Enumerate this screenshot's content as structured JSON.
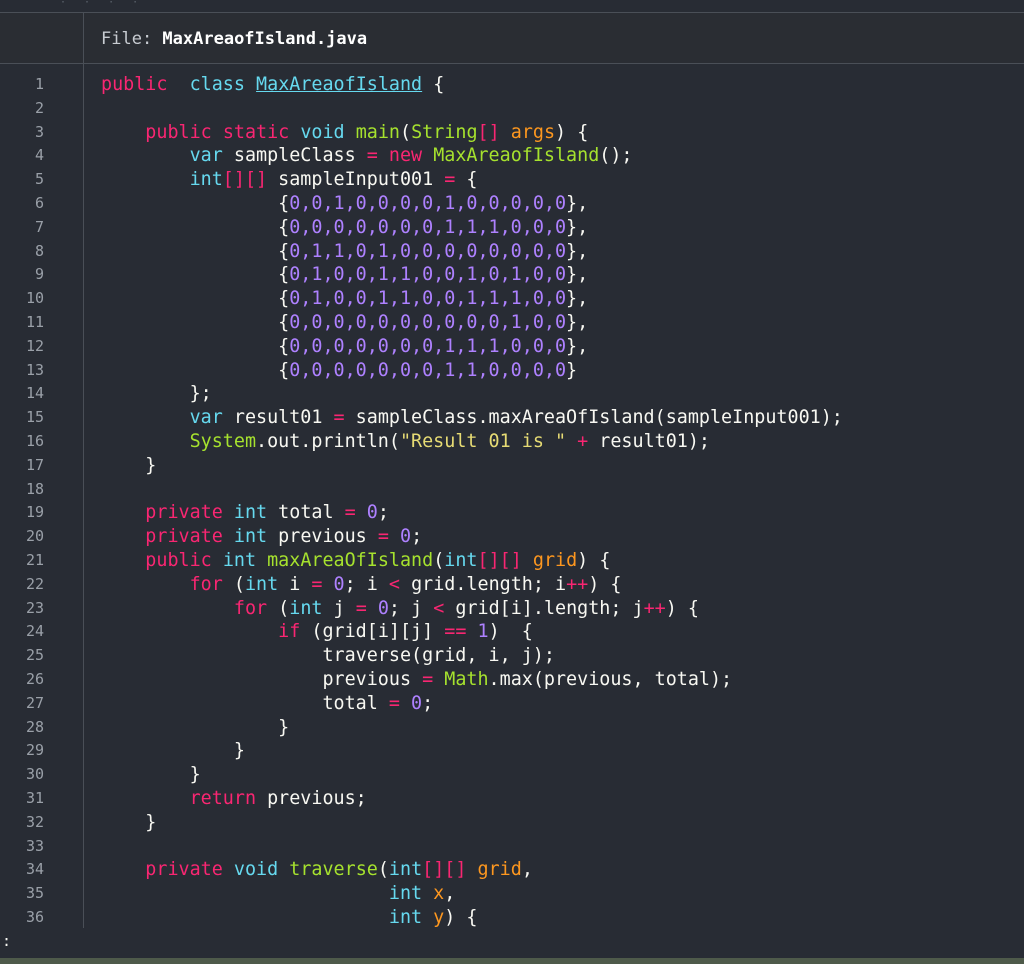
{
  "window": {
    "file_prefix": "File: ",
    "file_name": "MaxAreaofIsland.java"
  },
  "colors": {
    "background": "#282c34",
    "keyword": "#f92672",
    "type": "#66d9ef",
    "function": "#a6e22e",
    "number": "#ae81ff",
    "string": "#e6db74",
    "parameter": "#fd971f"
  },
  "code_lines": [
    {
      "n": "1",
      "tokens": [
        [
          "kw",
          "public"
        ],
        [
          "",
          "  "
        ],
        [
          "ty",
          "class"
        ],
        [
          "",
          " "
        ],
        [
          "ul",
          "MaxAreaofIsland"
        ],
        [
          "",
          " {"
        ]
      ]
    },
    {
      "n": "2",
      "tokens": []
    },
    {
      "n": "3",
      "tokens": [
        [
          "",
          "    "
        ],
        [
          "kw",
          "public"
        ],
        [
          "",
          " "
        ],
        [
          "kw",
          "static"
        ],
        [
          "",
          " "
        ],
        [
          "ty",
          "void"
        ],
        [
          "",
          " "
        ],
        [
          "fn",
          "main"
        ],
        [
          "",
          "("
        ],
        [
          "fn",
          "String"
        ],
        [
          "kw",
          "[]"
        ],
        [
          "",
          " "
        ],
        [
          "pa",
          "args"
        ],
        [
          "",
          ") {"
        ]
      ]
    },
    {
      "n": "4",
      "tokens": [
        [
          "",
          "        "
        ],
        [
          "ty",
          "var"
        ],
        [
          "",
          " sampleClass "
        ],
        [
          "kw",
          "="
        ],
        [
          "",
          " "
        ],
        [
          "kw",
          "new"
        ],
        [
          "",
          " "
        ],
        [
          "fn",
          "MaxAreaofIsland"
        ],
        [
          "",
          "();"
        ]
      ]
    },
    {
      "n": "5",
      "tokens": [
        [
          "",
          "        "
        ],
        [
          "ty",
          "int"
        ],
        [
          "kw",
          "[][]"
        ],
        [
          "",
          " sampleInput001 "
        ],
        [
          "kw",
          "="
        ],
        [
          "",
          " {"
        ]
      ]
    },
    {
      "n": "6",
      "tokens": [
        [
          "",
          "                {"
        ],
        [
          "nu",
          "0,0,1,0,0,0,0,1,0,0,0,0,0"
        ],
        [
          "",
          "},"
        ]
      ]
    },
    {
      "n": "7",
      "tokens": [
        [
          "",
          "                {"
        ],
        [
          "nu",
          "0,0,0,0,0,0,0,1,1,1,0,0,0"
        ],
        [
          "",
          "},"
        ]
      ]
    },
    {
      "n": "8",
      "tokens": [
        [
          "",
          "                {"
        ],
        [
          "nu",
          "0,1,1,0,1,0,0,0,0,0,0,0,0"
        ],
        [
          "",
          "},"
        ]
      ]
    },
    {
      "n": "9",
      "tokens": [
        [
          "",
          "                {"
        ],
        [
          "nu",
          "0,1,0,0,1,1,0,0,1,0,1,0,0"
        ],
        [
          "",
          "},"
        ]
      ]
    },
    {
      "n": "10",
      "tokens": [
        [
          "",
          "                {"
        ],
        [
          "nu",
          "0,1,0,0,1,1,0,0,1,1,1,0,0"
        ],
        [
          "",
          "},"
        ]
      ]
    },
    {
      "n": "11",
      "tokens": [
        [
          "",
          "                {"
        ],
        [
          "nu",
          "0,0,0,0,0,0,0,0,0,0,1,0,0"
        ],
        [
          "",
          "},"
        ]
      ]
    },
    {
      "n": "12",
      "tokens": [
        [
          "",
          "                {"
        ],
        [
          "nu",
          "0,0,0,0,0,0,0,1,1,1,0,0,0"
        ],
        [
          "",
          "},"
        ]
      ]
    },
    {
      "n": "13",
      "tokens": [
        [
          "",
          "                {"
        ],
        [
          "nu",
          "0,0,0,0,0,0,0,1,1,0,0,0,0"
        ],
        [
          "",
          "}"
        ]
      ]
    },
    {
      "n": "14",
      "tokens": [
        [
          "",
          "        };"
        ]
      ]
    },
    {
      "n": "15",
      "tokens": [
        [
          "",
          "        "
        ],
        [
          "ty",
          "var"
        ],
        [
          "",
          " result01 "
        ],
        [
          "kw",
          "="
        ],
        [
          "",
          " sampleClass.maxAreaOfIsland(sampleInput001);"
        ]
      ]
    },
    {
      "n": "16",
      "tokens": [
        [
          "",
          "        "
        ],
        [
          "fn",
          "System"
        ],
        [
          "",
          ".out.println("
        ],
        [
          "st",
          "\"Result 01 is \""
        ],
        [
          "",
          " "
        ],
        [
          "kw",
          "+"
        ],
        [
          "",
          " result01);"
        ]
      ]
    },
    {
      "n": "17",
      "tokens": [
        [
          "",
          "    }"
        ]
      ]
    },
    {
      "n": "18",
      "tokens": []
    },
    {
      "n": "19",
      "tokens": [
        [
          "",
          "    "
        ],
        [
          "kw",
          "private"
        ],
        [
          "",
          " "
        ],
        [
          "ty",
          "int"
        ],
        [
          "",
          " total "
        ],
        [
          "kw",
          "="
        ],
        [
          "",
          " "
        ],
        [
          "nu",
          "0"
        ],
        [
          "",
          ";"
        ]
      ]
    },
    {
      "n": "20",
      "tokens": [
        [
          "",
          "    "
        ],
        [
          "kw",
          "private"
        ],
        [
          "",
          " "
        ],
        [
          "ty",
          "int"
        ],
        [
          "",
          " previous "
        ],
        [
          "kw",
          "="
        ],
        [
          "",
          " "
        ],
        [
          "nu",
          "0"
        ],
        [
          "",
          ";"
        ]
      ]
    },
    {
      "n": "21",
      "tokens": [
        [
          "",
          "    "
        ],
        [
          "kw",
          "public"
        ],
        [
          "",
          " "
        ],
        [
          "ty",
          "int"
        ],
        [
          "",
          " "
        ],
        [
          "fn",
          "maxAreaOfIsland"
        ],
        [
          "",
          "("
        ],
        [
          "ty",
          "int"
        ],
        [
          "kw",
          "[][]"
        ],
        [
          "",
          " "
        ],
        [
          "pa",
          "grid"
        ],
        [
          "",
          ") {"
        ]
      ]
    },
    {
      "n": "22",
      "tokens": [
        [
          "",
          "        "
        ],
        [
          "kw",
          "for"
        ],
        [
          "",
          " ("
        ],
        [
          "ty",
          "int"
        ],
        [
          "",
          " i "
        ],
        [
          "kw",
          "="
        ],
        [
          "",
          " "
        ],
        [
          "nu",
          "0"
        ],
        [
          "",
          "; i "
        ],
        [
          "kw",
          "<"
        ],
        [
          "",
          " grid.length; i"
        ],
        [
          "kw",
          "++"
        ],
        [
          "",
          ") {"
        ]
      ]
    },
    {
      "n": "23",
      "tokens": [
        [
          "",
          "            "
        ],
        [
          "kw",
          "for"
        ],
        [
          "",
          " ("
        ],
        [
          "ty",
          "int"
        ],
        [
          "",
          " j "
        ],
        [
          "kw",
          "="
        ],
        [
          "",
          " "
        ],
        [
          "nu",
          "0"
        ],
        [
          "",
          "; j "
        ],
        [
          "kw",
          "<"
        ],
        [
          "",
          " grid[i].length; j"
        ],
        [
          "kw",
          "++"
        ],
        [
          "",
          ") {"
        ]
      ]
    },
    {
      "n": "24",
      "tokens": [
        [
          "",
          "                "
        ],
        [
          "kw",
          "if"
        ],
        [
          "",
          " (grid[i][j] "
        ],
        [
          "kw",
          "=="
        ],
        [
          "",
          " "
        ],
        [
          "nu",
          "1"
        ],
        [
          "",
          ")  {"
        ]
      ]
    },
    {
      "n": "25",
      "tokens": [
        [
          "",
          "                    traverse(grid, i, j);"
        ]
      ]
    },
    {
      "n": "26",
      "tokens": [
        [
          "",
          "                    previous "
        ],
        [
          "kw",
          "="
        ],
        [
          "",
          " "
        ],
        [
          "fn",
          "Math"
        ],
        [
          "",
          ".max(previous, total);"
        ]
      ]
    },
    {
      "n": "27",
      "tokens": [
        [
          "",
          "                    total "
        ],
        [
          "kw",
          "="
        ],
        [
          "",
          " "
        ],
        [
          "nu",
          "0"
        ],
        [
          "",
          ";"
        ]
      ]
    },
    {
      "n": "28",
      "tokens": [
        [
          "",
          "                }"
        ]
      ]
    },
    {
      "n": "29",
      "tokens": [
        [
          "",
          "            }"
        ]
      ]
    },
    {
      "n": "30",
      "tokens": [
        [
          "",
          "        }"
        ]
      ]
    },
    {
      "n": "31",
      "tokens": [
        [
          "",
          "        "
        ],
        [
          "kw",
          "return"
        ],
        [
          "",
          " previous;"
        ]
      ]
    },
    {
      "n": "32",
      "tokens": [
        [
          "",
          "    }"
        ]
      ]
    },
    {
      "n": "33",
      "tokens": []
    },
    {
      "n": "34",
      "tokens": [
        [
          "",
          "    "
        ],
        [
          "kw",
          "private"
        ],
        [
          "",
          " "
        ],
        [
          "ty",
          "void"
        ],
        [
          "",
          " "
        ],
        [
          "fn",
          "traverse"
        ],
        [
          "",
          "("
        ],
        [
          "ty",
          "int"
        ],
        [
          "kw",
          "[][]"
        ],
        [
          "",
          " "
        ],
        [
          "pa",
          "grid"
        ],
        [
          "",
          ","
        ]
      ]
    },
    {
      "n": "35",
      "tokens": [
        [
          "",
          "                          "
        ],
        [
          "ty",
          "int"
        ],
        [
          "",
          " "
        ],
        [
          "pa",
          "x"
        ],
        [
          "",
          ","
        ]
      ]
    },
    {
      "n": "36",
      "tokens": [
        [
          "",
          "                          "
        ],
        [
          "ty",
          "int"
        ],
        [
          "",
          " "
        ],
        [
          "pa",
          "y"
        ],
        [
          "",
          ") {"
        ]
      ]
    }
  ],
  "pager_prompt": ":"
}
